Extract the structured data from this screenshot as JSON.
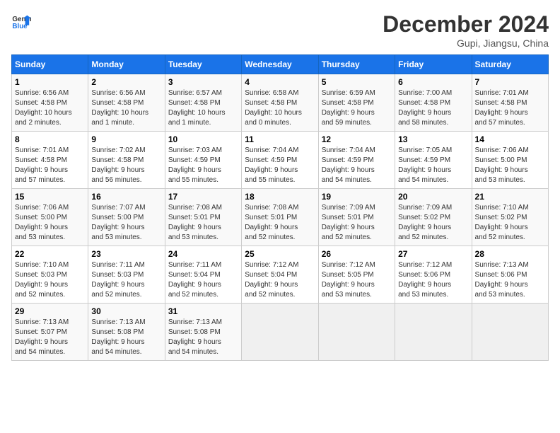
{
  "logo": {
    "line1": "General",
    "line2": "Blue"
  },
  "title": "December 2024",
  "subtitle": "Gupi, Jiangsu, China",
  "days_of_week": [
    "Sunday",
    "Monday",
    "Tuesday",
    "Wednesday",
    "Thursday",
    "Friday",
    "Saturday"
  ],
  "weeks": [
    [
      {
        "day": "1",
        "info": "Sunrise: 6:56 AM\nSunset: 4:58 PM\nDaylight: 10 hours\nand 2 minutes."
      },
      {
        "day": "2",
        "info": "Sunrise: 6:56 AM\nSunset: 4:58 PM\nDaylight: 10 hours\nand 1 minute."
      },
      {
        "day": "3",
        "info": "Sunrise: 6:57 AM\nSunset: 4:58 PM\nDaylight: 10 hours\nand 1 minute."
      },
      {
        "day": "4",
        "info": "Sunrise: 6:58 AM\nSunset: 4:58 PM\nDaylight: 10 hours\nand 0 minutes."
      },
      {
        "day": "5",
        "info": "Sunrise: 6:59 AM\nSunset: 4:58 PM\nDaylight: 9 hours\nand 59 minutes."
      },
      {
        "day": "6",
        "info": "Sunrise: 7:00 AM\nSunset: 4:58 PM\nDaylight: 9 hours\nand 58 minutes."
      },
      {
        "day": "7",
        "info": "Sunrise: 7:01 AM\nSunset: 4:58 PM\nDaylight: 9 hours\nand 57 minutes."
      }
    ],
    [
      {
        "day": "8",
        "info": "Sunrise: 7:01 AM\nSunset: 4:58 PM\nDaylight: 9 hours\nand 57 minutes."
      },
      {
        "day": "9",
        "info": "Sunrise: 7:02 AM\nSunset: 4:58 PM\nDaylight: 9 hours\nand 56 minutes."
      },
      {
        "day": "10",
        "info": "Sunrise: 7:03 AM\nSunset: 4:59 PM\nDaylight: 9 hours\nand 55 minutes."
      },
      {
        "day": "11",
        "info": "Sunrise: 7:04 AM\nSunset: 4:59 PM\nDaylight: 9 hours\nand 55 minutes."
      },
      {
        "day": "12",
        "info": "Sunrise: 7:04 AM\nSunset: 4:59 PM\nDaylight: 9 hours\nand 54 minutes."
      },
      {
        "day": "13",
        "info": "Sunrise: 7:05 AM\nSunset: 4:59 PM\nDaylight: 9 hours\nand 54 minutes."
      },
      {
        "day": "14",
        "info": "Sunrise: 7:06 AM\nSunset: 5:00 PM\nDaylight: 9 hours\nand 53 minutes."
      }
    ],
    [
      {
        "day": "15",
        "info": "Sunrise: 7:06 AM\nSunset: 5:00 PM\nDaylight: 9 hours\nand 53 minutes."
      },
      {
        "day": "16",
        "info": "Sunrise: 7:07 AM\nSunset: 5:00 PM\nDaylight: 9 hours\nand 53 minutes."
      },
      {
        "day": "17",
        "info": "Sunrise: 7:08 AM\nSunset: 5:01 PM\nDaylight: 9 hours\nand 53 minutes."
      },
      {
        "day": "18",
        "info": "Sunrise: 7:08 AM\nSunset: 5:01 PM\nDaylight: 9 hours\nand 52 minutes."
      },
      {
        "day": "19",
        "info": "Sunrise: 7:09 AM\nSunset: 5:01 PM\nDaylight: 9 hours\nand 52 minutes."
      },
      {
        "day": "20",
        "info": "Sunrise: 7:09 AM\nSunset: 5:02 PM\nDaylight: 9 hours\nand 52 minutes."
      },
      {
        "day": "21",
        "info": "Sunrise: 7:10 AM\nSunset: 5:02 PM\nDaylight: 9 hours\nand 52 minutes."
      }
    ],
    [
      {
        "day": "22",
        "info": "Sunrise: 7:10 AM\nSunset: 5:03 PM\nDaylight: 9 hours\nand 52 minutes."
      },
      {
        "day": "23",
        "info": "Sunrise: 7:11 AM\nSunset: 5:03 PM\nDaylight: 9 hours\nand 52 minutes."
      },
      {
        "day": "24",
        "info": "Sunrise: 7:11 AM\nSunset: 5:04 PM\nDaylight: 9 hours\nand 52 minutes."
      },
      {
        "day": "25",
        "info": "Sunrise: 7:12 AM\nSunset: 5:04 PM\nDaylight: 9 hours\nand 52 minutes."
      },
      {
        "day": "26",
        "info": "Sunrise: 7:12 AM\nSunset: 5:05 PM\nDaylight: 9 hours\nand 53 minutes."
      },
      {
        "day": "27",
        "info": "Sunrise: 7:12 AM\nSunset: 5:06 PM\nDaylight: 9 hours\nand 53 minutes."
      },
      {
        "day": "28",
        "info": "Sunrise: 7:13 AM\nSunset: 5:06 PM\nDaylight: 9 hours\nand 53 minutes."
      }
    ],
    [
      {
        "day": "29",
        "info": "Sunrise: 7:13 AM\nSunset: 5:07 PM\nDaylight: 9 hours\nand 54 minutes."
      },
      {
        "day": "30",
        "info": "Sunrise: 7:13 AM\nSunset: 5:08 PM\nDaylight: 9 hours\nand 54 minutes."
      },
      {
        "day": "31",
        "info": "Sunrise: 7:13 AM\nSunset: 5:08 PM\nDaylight: 9 hours\nand 54 minutes."
      },
      {
        "day": "",
        "info": ""
      },
      {
        "day": "",
        "info": ""
      },
      {
        "day": "",
        "info": ""
      },
      {
        "day": "",
        "info": ""
      }
    ]
  ]
}
